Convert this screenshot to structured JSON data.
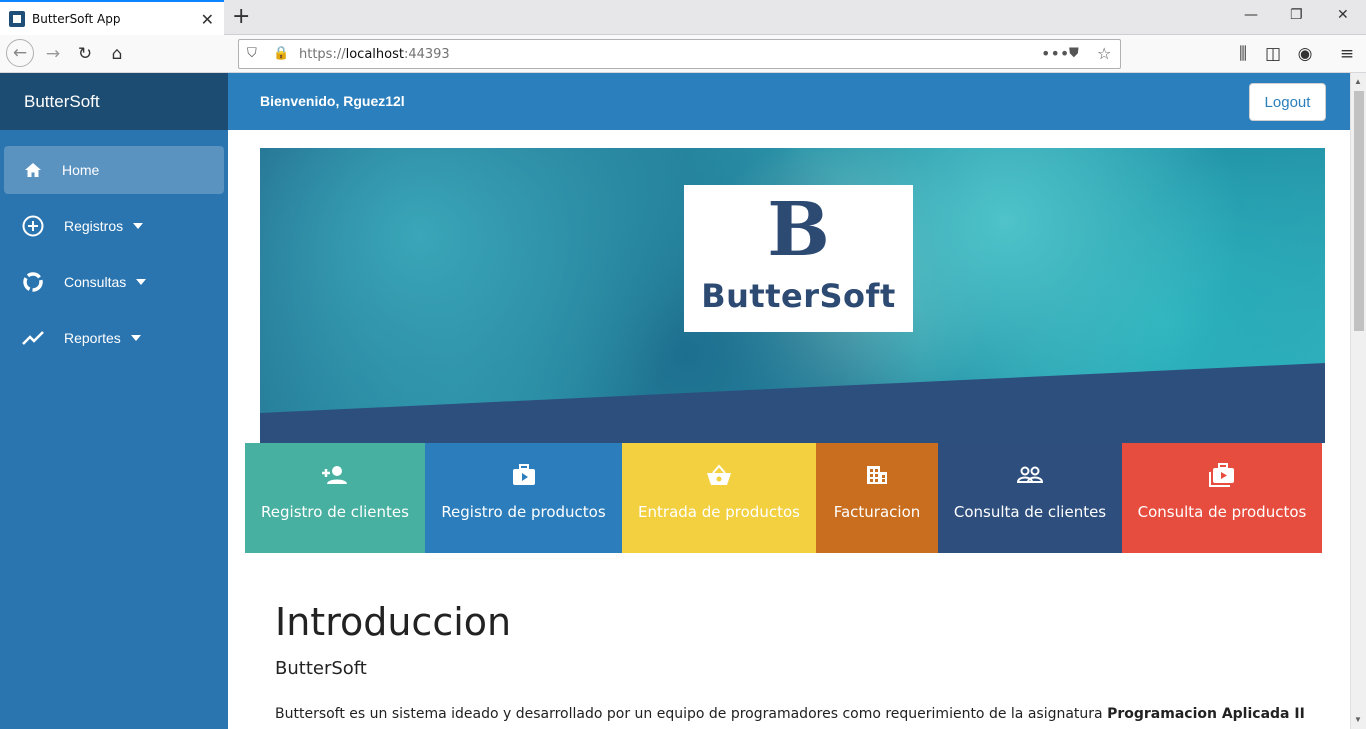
{
  "browser": {
    "tab_title": "ButterSoft App",
    "url_prefix": "https://",
    "url_host": "localhost",
    "url_port": ":44393"
  },
  "sidebar": {
    "brand": "ButterSoft",
    "items": [
      {
        "label": "Home",
        "icon": "home-icon"
      },
      {
        "label": "Registros",
        "icon": "add-circle-icon"
      },
      {
        "label": "Consultas",
        "icon": "circle-notch-icon"
      },
      {
        "label": "Reportes",
        "icon": "trend-line-icon"
      }
    ]
  },
  "header": {
    "welcome": "Bienvenido, Rguez12l",
    "logout_label": "Logout"
  },
  "banner": {
    "logo_letter": "B",
    "logo_name": "ButterSoft"
  },
  "tiles": [
    {
      "label": "Registro de clientes",
      "icon": "person-add-icon",
      "color": "#47b0a0"
    },
    {
      "label": "Registro de productos",
      "icon": "briefcase-play-icon",
      "color": "#2b7dbc"
    },
    {
      "label": "Entrada de productos",
      "icon": "basket-icon",
      "color": "#f2d040"
    },
    {
      "label": "Facturacion",
      "icon": "building-icon",
      "color": "#c96e1f"
    },
    {
      "label": "Consulta de clientes",
      "icon": "people-icon",
      "color": "#2e4f7e"
    },
    {
      "label": "Consulta de productos",
      "icon": "briefcase-stack-icon",
      "color": "#e64d3f"
    }
  ],
  "content": {
    "title": "Introduccion",
    "subtitle": "ButterSoft",
    "body_text": "Buttersoft es un sistema ideado y desarrollado por un equipo de programadores como requerimiento de la asignatura ",
    "body_bold": "Programacion Aplicada II"
  },
  "colors": {
    "sidebar": "#2a75b0",
    "sidebar_brand": "#1d4c73",
    "topbar": "#2a7fbc",
    "banner_ribbon": "#2d4f7e"
  }
}
